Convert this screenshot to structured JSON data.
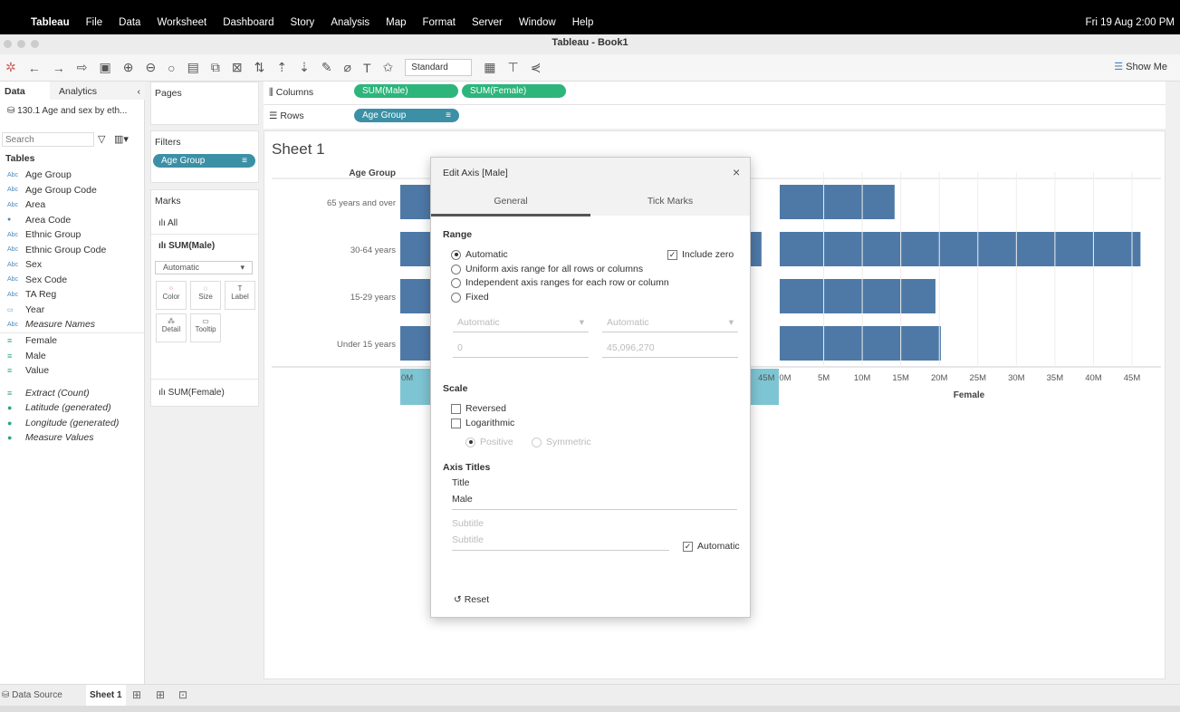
{
  "menubar": {
    "app": "Tableau",
    "items": [
      "File",
      "Data",
      "Worksheet",
      "Dashboard",
      "Story",
      "Analysis",
      "Map",
      "Format",
      "Server",
      "Window",
      "Help"
    ],
    "clock": "Fri 19 Aug  2:00 PM"
  },
  "window": {
    "title": "Tableau - Book1"
  },
  "toolbar": {
    "fit_select": "Standard",
    "show_me": "Show Me"
  },
  "left": {
    "tab_data": "Data",
    "tab_analytics": "Analytics",
    "datasource": "130.1 Age and sex by eth...",
    "search_placeholder": "Search",
    "tables_header": "Tables",
    "dimensions": [
      {
        "type": "Abc",
        "name": "Age Group"
      },
      {
        "type": "Abc",
        "name": "Age Group Code"
      },
      {
        "type": "Abc",
        "name": "Area"
      },
      {
        "type": "globe",
        "name": "Area Code"
      },
      {
        "type": "Abc",
        "name": "Ethnic Group"
      },
      {
        "type": "Abc",
        "name": "Ethnic Group Code"
      },
      {
        "type": "Abc",
        "name": "Sex"
      },
      {
        "type": "Abc",
        "name": "Sex Code"
      },
      {
        "type": "Abc",
        "name": "TA Reg"
      },
      {
        "type": "date",
        "name": "Year"
      },
      {
        "type": "Abc",
        "name": "Measure Names"
      }
    ],
    "measures": [
      "Female",
      "Male",
      "Value",
      "Extract (Count)",
      "Latitude (generated)",
      "Longitude (generated)",
      "Measure Values"
    ]
  },
  "cards": {
    "pages": "Pages",
    "filters": "Filters",
    "filter_pill": "Age Group",
    "marks": "Marks",
    "marks_all": "All",
    "marks_male": "SUM(Male)",
    "mark_type": "Automatic",
    "color": "Color",
    "size": "Size",
    "label": "Label",
    "detail": "Detail",
    "tooltip": "Tooltip",
    "marks_female": "SUM(Female)"
  },
  "shelves": {
    "columns": "Columns",
    "rows": "Rows",
    "col_pills": [
      "SUM(Male)",
      "SUM(Female)"
    ],
    "row_pill": "Age Group"
  },
  "sheet": {
    "title": "Sheet 1",
    "row_header": "Age Group"
  },
  "chart_data": {
    "type": "bar",
    "orientation": "horizontal",
    "categories": [
      "65 years and over",
      "30-64 years",
      "15-29 years",
      "Under 15 years"
    ],
    "series": [
      {
        "name": "Male",
        "values": [
          13000000,
          44100000,
          20000000,
          21000000
        ]
      },
      {
        "name": "Female",
        "values": [
          14200000,
          46100000,
          19500000,
          20200000
        ]
      }
    ],
    "male_axis": {
      "ticks_visible": [
        "0M",
        "45M"
      ],
      "xlim": [
        0,
        45096270
      ]
    },
    "female_axis": {
      "title": "Female",
      "ticks": [
        "0M",
        "5M",
        "10M",
        "15M",
        "20M",
        "25M",
        "30M",
        "35M",
        "40M",
        "45M"
      ],
      "xlim": [
        0,
        47000000
      ]
    },
    "bar_color": "#4e79a7",
    "highlight_color": "#7ec5d3"
  },
  "dialog": {
    "title": "Edit Axis [Male]",
    "tab_general": "General",
    "tab_tick": "Tick Marks",
    "range": "Range",
    "range_options": [
      "Automatic",
      "Uniform axis range for all rows or columns",
      "Independent axis ranges for each row or column",
      "Fixed"
    ],
    "range_selected": 0,
    "include_zero": "Include zero",
    "include_zero_checked": true,
    "start_select": "Automatic",
    "end_select": "Automatic",
    "start_value": "0",
    "end_value": "45,096,270",
    "scale": "Scale",
    "reversed": "Reversed",
    "logarithmic": "Logarithmic",
    "positive": "Positive",
    "symmetric": "Symmetric",
    "axis_titles": "Axis Titles",
    "title_label": "Title",
    "title_value": "Male",
    "subtitle_label": "Subtitle",
    "subtitle_placeholder": "Subtitle",
    "automatic": "Automatic",
    "reset": "Reset"
  },
  "bottom": {
    "datasource": "Data Source",
    "sheet": "Sheet 1"
  }
}
